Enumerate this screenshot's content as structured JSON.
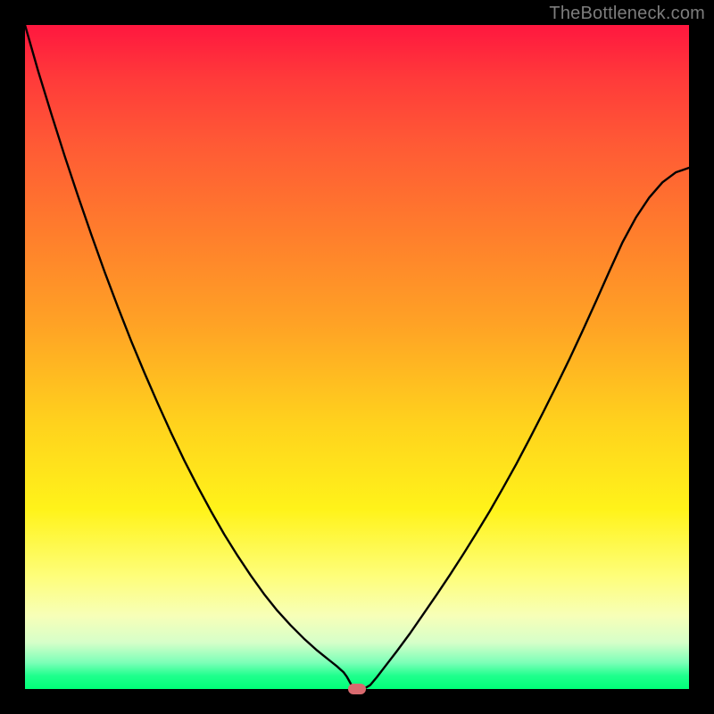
{
  "watermark": "TheBottleneck.com",
  "chart_data": {
    "type": "line",
    "title": "",
    "xlabel": "",
    "ylabel": "",
    "xlim": [
      0,
      1
    ],
    "ylim": [
      0,
      1
    ],
    "x": [
      0.0,
      0.02,
      0.04,
      0.06,
      0.08,
      0.1,
      0.12,
      0.14,
      0.16,
      0.18,
      0.2,
      0.22,
      0.24,
      0.26,
      0.28,
      0.3,
      0.32,
      0.34,
      0.36,
      0.38,
      0.4,
      0.42,
      0.44,
      0.45,
      0.46,
      0.47,
      0.48,
      0.485,
      0.49,
      0.495,
      0.5,
      0.505,
      0.51,
      0.52,
      0.53,
      0.54,
      0.56,
      0.58,
      0.6,
      0.62,
      0.64,
      0.66,
      0.68,
      0.7,
      0.72,
      0.74,
      0.76,
      0.78,
      0.8,
      0.82,
      0.84,
      0.86,
      0.88,
      0.9,
      0.92,
      0.94,
      0.96,
      0.98,
      1.0
    ],
    "values": [
      1.0,
      0.93,
      0.865,
      0.802,
      0.742,
      0.684,
      0.628,
      0.575,
      0.524,
      0.476,
      0.43,
      0.386,
      0.344,
      0.305,
      0.268,
      0.233,
      0.201,
      0.171,
      0.143,
      0.118,
      0.096,
      0.076,
      0.058,
      0.05,
      0.042,
      0.034,
      0.025,
      0.018,
      0.009,
      0.0,
      0.0,
      0.0,
      0.0,
      0.006,
      0.018,
      0.031,
      0.057,
      0.084,
      0.113,
      0.142,
      0.172,
      0.203,
      0.235,
      0.268,
      0.303,
      0.339,
      0.377,
      0.416,
      0.456,
      0.497,
      0.54,
      0.584,
      0.629,
      0.673,
      0.71,
      0.74,
      0.763,
      0.778,
      0.785
    ],
    "marker": {
      "x": 0.5,
      "y": 0.0
    },
    "gradient_stops": [
      {
        "pos": 0.0,
        "color": "#ff173f"
      },
      {
        "pos": 0.3,
        "color": "#ff7a2d"
      },
      {
        "pos": 0.6,
        "color": "#ffd21d"
      },
      {
        "pos": 0.83,
        "color": "#fefe7a"
      },
      {
        "pos": 1.0,
        "color": "#00ff78"
      }
    ]
  }
}
